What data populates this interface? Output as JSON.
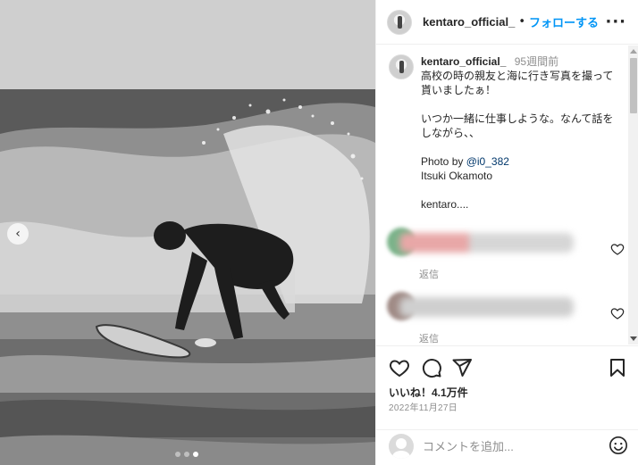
{
  "post": {
    "image": {
      "subject": "surfer-on-wave-photo",
      "carousel_dots": [
        false,
        false,
        true
      ]
    },
    "header": {
      "username": "kentaro_official_",
      "separator": "•",
      "follow_label": "フォローする",
      "more_icon": "more-horizontal-icon"
    },
    "caption": {
      "username": "kentaro_official_",
      "time_ago": "95週間前",
      "line1": "高校の時の親友と海に行き写真を撮って貰いましたぁ！",
      "line2": "いつか一緒に仕事しような。なんて話をしながら、、",
      "photo_by_prefix": "Photo by ",
      "photo_by_handle": "@i0_382",
      "photographer": "Itsuki Okamoto",
      "truncated": "kentaro...."
    },
    "comments": [
      {
        "reply_label": "返信",
        "avatar_color": "#7bb38a",
        "text_color": "#e8a7a7"
      },
      {
        "reply_label": "返信",
        "avatar_color": "#a08b86",
        "text_color": "#c8c8c8"
      }
    ],
    "actions": {
      "like_icon": "heart-icon",
      "comment_icon": "comment-icon",
      "share_icon": "send-icon",
      "save_icon": "bookmark-icon",
      "likes_text": "いいね！4.1万件",
      "date_text": "2022年11月27日"
    },
    "comment_box": {
      "placeholder": "コメントを追加...",
      "emoji_icon": "emoji-smile-icon"
    },
    "colors": {
      "accent": "#0095f6",
      "text": "#262626",
      "muted": "#8e8e8e",
      "border": "#efefef"
    }
  }
}
